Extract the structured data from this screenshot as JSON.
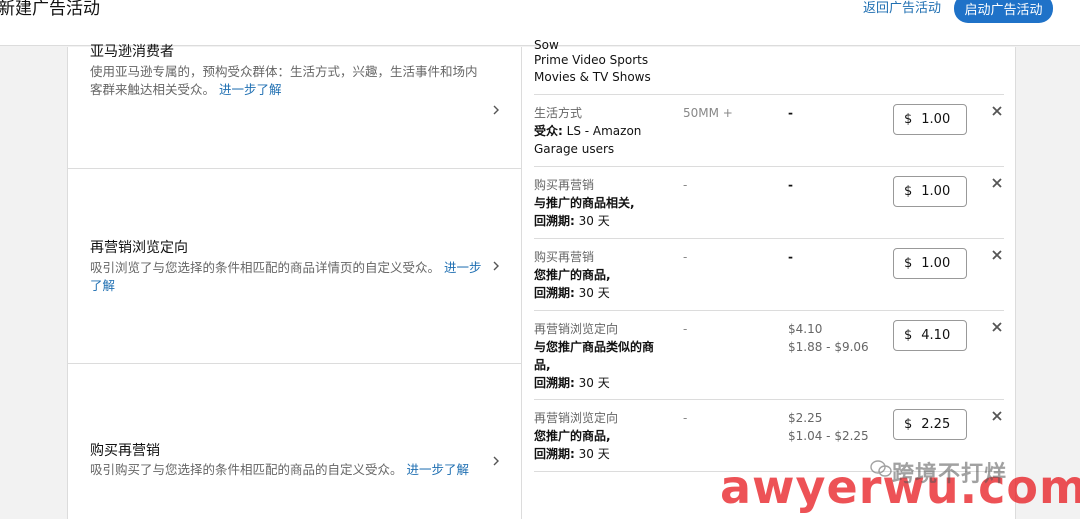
{
  "header": {
    "title": "新建广告活动",
    "back_link": "返回广告活动",
    "launch_button": "启动广告活动"
  },
  "audiences": [
    {
      "title": "亚马逊消费者",
      "description": "使用亚马逊专属的，预构受众群体：生活方式，兴趣，生活事件和场内客群来触达相关受众。",
      "learn_more": "进一步了解"
    },
    {
      "title": "再营销浏览定向",
      "description": "吸引浏览了与您选择的条件相匹配的商品详情页的自定义受众。",
      "learn_more": "进一步了解"
    },
    {
      "title": "购买再营销",
      "description": "吸引购买了与您选择的条件相匹配的商品的自定义受众。",
      "learn_more": "进一步了解"
    }
  ],
  "targets_top": {
    "cut_line": "Sow",
    "line1": "Prime Video Sports",
    "line2": "Movies & TV Shows"
  },
  "targets": [
    {
      "type": "生活方式",
      "detail_label": "受众:",
      "detail_value": "LS - Amazon Garage users",
      "lookback_label": "",
      "lookback_value": "",
      "size": "50MM +",
      "bid": "-",
      "bid_range": "",
      "currency": "$",
      "value": "1.00"
    },
    {
      "type": "购买再营销",
      "detail_label": "与推广的商品相关,",
      "detail_value": "",
      "lookback_label": "回溯期:",
      "lookback_value": "30 天",
      "size": "-",
      "bid": "-",
      "bid_range": "",
      "currency": "$",
      "value": "1.00"
    },
    {
      "type": "购买再营销",
      "detail_label": "您推广的商品,",
      "detail_value": "",
      "lookback_label": "回溯期:",
      "lookback_value": "30 天",
      "size": "-",
      "bid": "-",
      "bid_range": "",
      "currency": "$",
      "value": "1.00"
    },
    {
      "type": "再营销浏览定向",
      "detail_label": "与您推广商品类似的商品,",
      "detail_value": "",
      "lookback_label": "回溯期:",
      "lookback_value": "30 天",
      "size": "-",
      "bid": "$4.10",
      "bid_range": "$1.88 - $9.06",
      "currency": "$",
      "value": "4.10"
    },
    {
      "type": "再营销浏览定向",
      "detail_label": "您推广的商品,",
      "detail_value": "",
      "lookback_label": "回溯期:",
      "lookback_value": "30 天",
      "size": "-",
      "bid": "$2.25",
      "bid_range": "$1.04 - $2.25",
      "currency": "$",
      "value": "2.25"
    }
  ],
  "watermark": {
    "cn": "跨境不打烊",
    "en": "awyerwu.com"
  },
  "colors": {
    "accent": "#1f72c8",
    "link": "#1f6fb2"
  }
}
